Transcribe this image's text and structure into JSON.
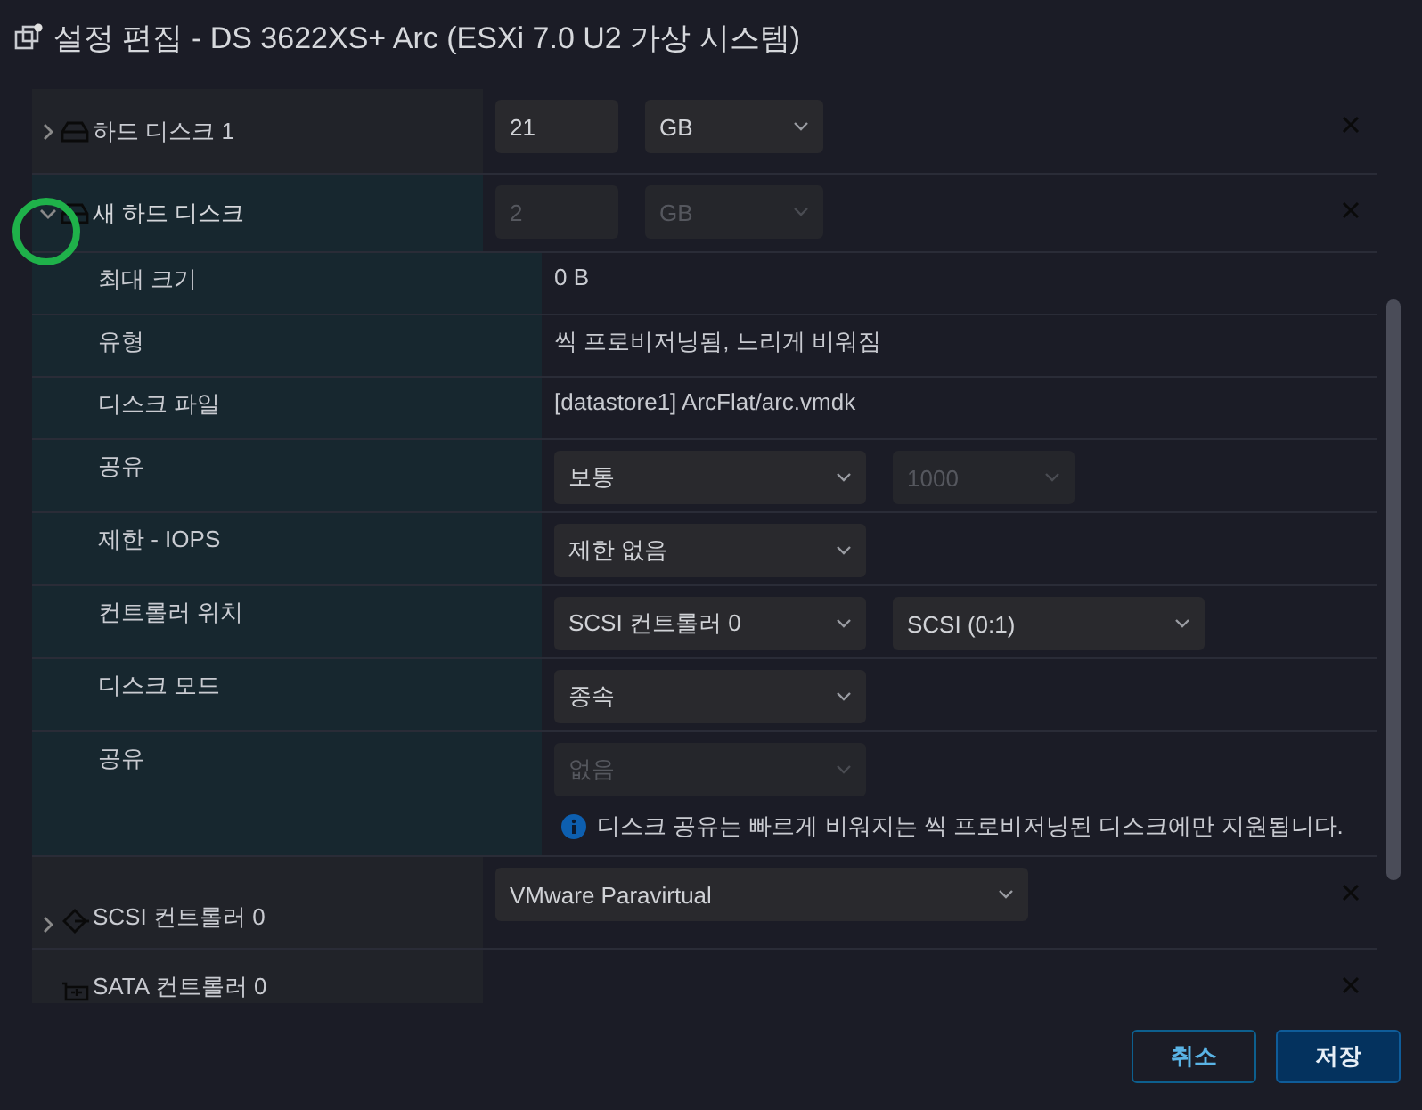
{
  "window": {
    "title": "설정 편집 - DS 3622XS+ Arc (ESXi 7.0 U2 가상 시스템)"
  },
  "devices": [
    {
      "kind": "disk",
      "label": "하드 디스크 1",
      "expandable": true,
      "expanded": false,
      "highlighted": false,
      "controls": [
        {
          "kind": "input",
          "value": "21",
          "disabled": false
        },
        {
          "kind": "unit",
          "value": "GB",
          "disabled": false
        }
      ]
    },
    {
      "kind": "disk",
      "label": "새 하드 디스크",
      "expandable": true,
      "expanded": true,
      "highlighted": true,
      "controls": [
        {
          "kind": "input",
          "value": "2",
          "disabled": true
        },
        {
          "kind": "unit",
          "value": "GB",
          "disabled": true
        }
      ],
      "properties": [
        {
          "label": "최대 크기",
          "value": "0 B"
        },
        {
          "label": "유형",
          "value": "씩 프로비저닝됨, 느리게 비워짐"
        },
        {
          "label": "디스크 파일",
          "value": "[datastore1] ArcFlat/arc.vmdk"
        },
        {
          "label": "공유",
          "controls": [
            {
              "kind": "select",
              "value": "보통",
              "disabled": false
            },
            {
              "kind": "spin",
              "value": "1000",
              "disabled": true
            }
          ]
        },
        {
          "label": "제한 - IOPS",
          "controls": [
            {
              "kind": "select",
              "value": "제한 없음",
              "disabled": false
            }
          ]
        },
        {
          "label": "컨트롤러 위치",
          "controls": [
            {
              "kind": "select",
              "value": "SCSI 컨트롤러 0",
              "disabled": false
            },
            {
              "kind": "select",
              "value": "SCSI (0:1)",
              "disabled": false
            }
          ]
        },
        {
          "label": "디스크 모드",
          "controls": [
            {
              "kind": "select",
              "value": "종속",
              "disabled": false
            }
          ]
        },
        {
          "label": "공유",
          "controls": [
            {
              "kind": "select",
              "value": "없음",
              "disabled": true
            }
          ],
          "note": "디스크 공유는 빠르게 비워지는 씩 프로비저닝된 디스크에만 지원됩니다."
        }
      ]
    },
    {
      "kind": "scsi",
      "label": "SCSI 컨트롤러 0",
      "expandable": true,
      "expanded": false,
      "highlighted": false,
      "controls": [
        {
          "kind": "wide",
          "value": "VMware Paravirtual",
          "disabled": false
        }
      ]
    },
    {
      "kind": "sata",
      "label": "SATA 컨트롤러 0",
      "expandable": false,
      "expanded": false,
      "highlighted": false
    }
  ],
  "buttons": [
    {
      "label": "취소",
      "kind": "secondary"
    },
    {
      "label": "저장",
      "kind": "primary"
    }
  ]
}
